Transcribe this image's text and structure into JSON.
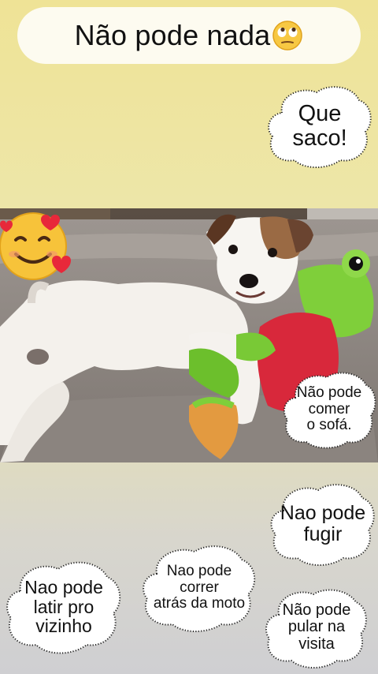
{
  "title": {
    "text": "Não pode nada",
    "emoji": "rolling-eyes-face-icon"
  },
  "bubbles": {
    "que_saco": "Que\nsaco!",
    "comer_sofa": "Não pode\ncomer\no sofá.",
    "fugir": "Nao pode\nfugir",
    "latir": "Nao pode\nlatir pro\nvizinho",
    "correr": "Nao pode\ncorrer\natrás da moto",
    "pular": "Não pode\npular na\nvisita"
  },
  "photo": {
    "subject": "dog-with-frog-plush-photo"
  },
  "sticker": {
    "emoji": "smiling-face-with-hearts-icon"
  },
  "colors": {
    "background_top": "#efe396",
    "background_bottom": "#cfcfd2",
    "title_pill": "#fdfbf0",
    "frog_green": "#7fcf3a",
    "frog_red": "#d8283b"
  }
}
